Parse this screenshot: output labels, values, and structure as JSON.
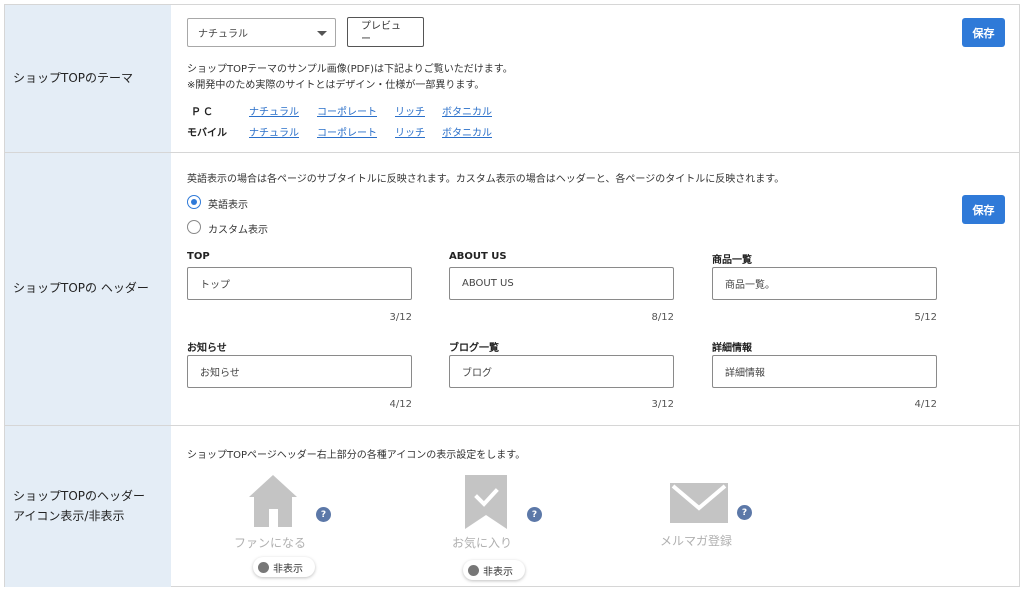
{
  "theme_row": {
    "label": "ショップTOPのテーマ",
    "select_value": "ナチュラル",
    "preview_label_line1": "プレビュ",
    "preview_label_line2": "ー",
    "save_label": "保存",
    "note_line1": "ショップTOPテーマのサンプル画像(PDF)は下記よりご覧いただけます。",
    "note_line2": "※開発中のため実際のサイトとはデザイン・仕様が一部異ります。",
    "pc_label": "ＰＣ",
    "mobile_label": "モバイル",
    "pc_links": [
      "ナチュラル",
      "コーポレート",
      "リッチ",
      "ボタニカル"
    ],
    "mobile_links": [
      "ナチュラル",
      "コーポレート",
      "リッチ",
      "ボタニカル"
    ]
  },
  "header_row": {
    "label": "ショップTOPの ヘッダー",
    "save_label": "保存",
    "description": "英語表示の場合は各ページのサブタイトルに反映されます。カスタム表示の場合はヘッダーと、各ページのタイトルに反映されます。",
    "radio_english": "英語表示",
    "radio_custom": "カスタム表示",
    "fields": [
      {
        "label": "TOP",
        "value": "トップ",
        "count": "3/12"
      },
      {
        "label": "ABOUT US",
        "value": "ABOUT US",
        "count": "8/12"
      },
      {
        "label": "商品一覧",
        "value": "商品一覧。",
        "count": "5/12"
      },
      {
        "label": "お知らせ",
        "value": "お知らせ",
        "count": "4/12"
      },
      {
        "label": "ブログ一覧",
        "value": "ブログ",
        "count": "3/12"
      },
      {
        "label": "詳細情報",
        "value": "詳細情報",
        "count": "4/12"
      }
    ]
  },
  "icon_row": {
    "label_line1": "ショップTOPのヘッダー",
    "label_line2": "アイコン表示/非表示",
    "description": "ショップTOPページヘッダー右上部分の各種アイコンの表示設定をします。",
    "help_glyph": "?",
    "icons": [
      {
        "caption": "ファンになる",
        "icon": "house-icon",
        "toggle": "非表示"
      },
      {
        "caption": "お気に入り",
        "icon": "bookmark-check-icon",
        "toggle": "非表示"
      },
      {
        "caption": "メルマガ登録",
        "icon": "envelope-icon"
      }
    ]
  },
  "colors": {
    "accent": "#2f7ad8",
    "label_bg": "#e4edf6",
    "link": "#2a6fc9",
    "icon_gray": "#c4c4c4",
    "help_badge": "#5c78a8"
  }
}
